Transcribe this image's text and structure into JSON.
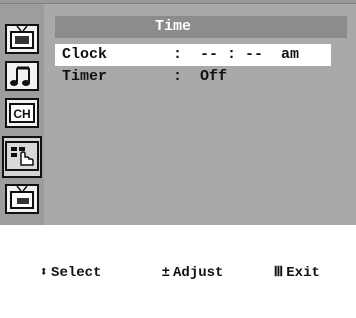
{
  "menu": {
    "title": "Time",
    "rows": [
      {
        "label": "Clock",
        "value": ":  -- : --  am"
      },
      {
        "label": "Timer",
        "value": ":  Off"
      }
    ]
  },
  "sidebar": {
    "icons": [
      "tv-picture-icon",
      "music-note-icon",
      "ch-icon",
      "setup-hand-icon",
      "tv-input-icon"
    ],
    "ch_label": "CH"
  },
  "footer": {
    "select": {
      "glyph": "⬍",
      "label": "Select"
    },
    "adjust": {
      "glyph": "±",
      "label": "Adjust"
    },
    "exit": {
      "glyph": "Ⅲ",
      "label": "Exit"
    }
  }
}
